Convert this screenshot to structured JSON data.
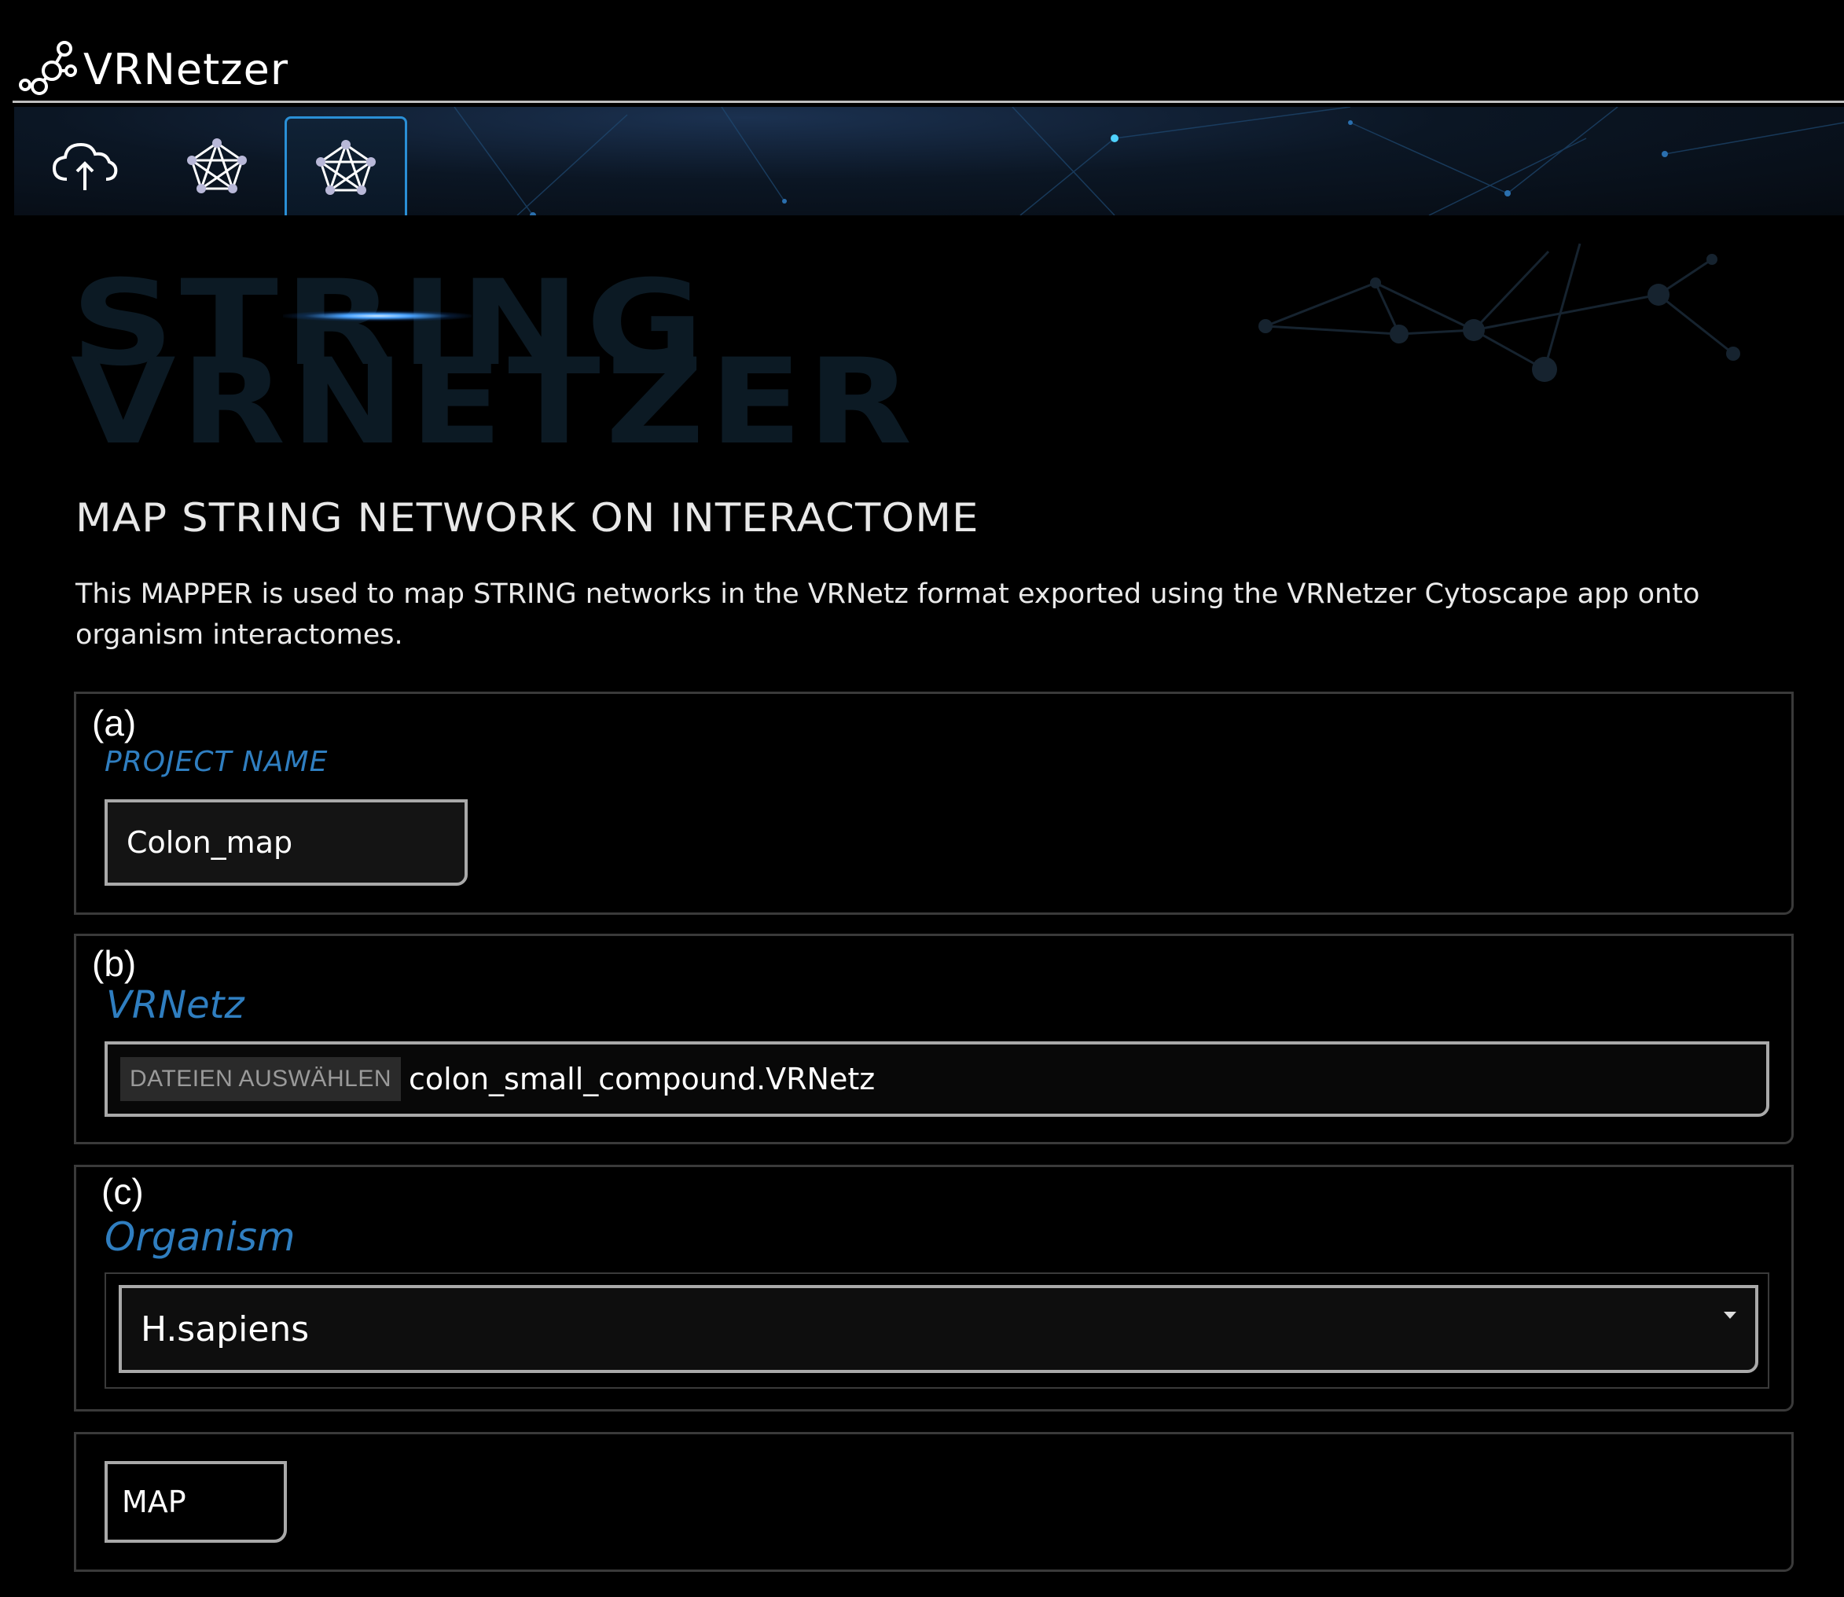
{
  "app": {
    "title": "VRNetzer"
  },
  "tabs": [
    {
      "icon": "cloud-upload-icon",
      "active": false
    },
    {
      "icon": "network-icon",
      "active": false
    },
    {
      "icon": "network-icon",
      "active": true
    }
  ],
  "hero": {
    "line1": "STRING",
    "line2": "VRNETZER"
  },
  "page": {
    "title": "MAP STRING NETWORK ON INTERACTOME",
    "description": "This MAPPER is used to map STRING networks in the VRNetz format exported using the VRNetzer Cytoscape app onto organism interactomes."
  },
  "form": {
    "project": {
      "letter": "(a)",
      "label": "PROJECT NAME",
      "value": "Colon_map"
    },
    "vrnetz": {
      "letter": "(b)",
      "label": "VRNetz",
      "button_label": "DATEIEN AUSWÄHLEN",
      "file_name": "colon_small_compound.VRNetz"
    },
    "organism": {
      "letter": "(c)",
      "label": "Organism",
      "selected": "H.sapiens"
    },
    "submit": {
      "label": "MAP"
    }
  },
  "colors": {
    "accent": "#2f7ec0",
    "active_tab_border": "#2a8fd6",
    "background": "#000000"
  }
}
